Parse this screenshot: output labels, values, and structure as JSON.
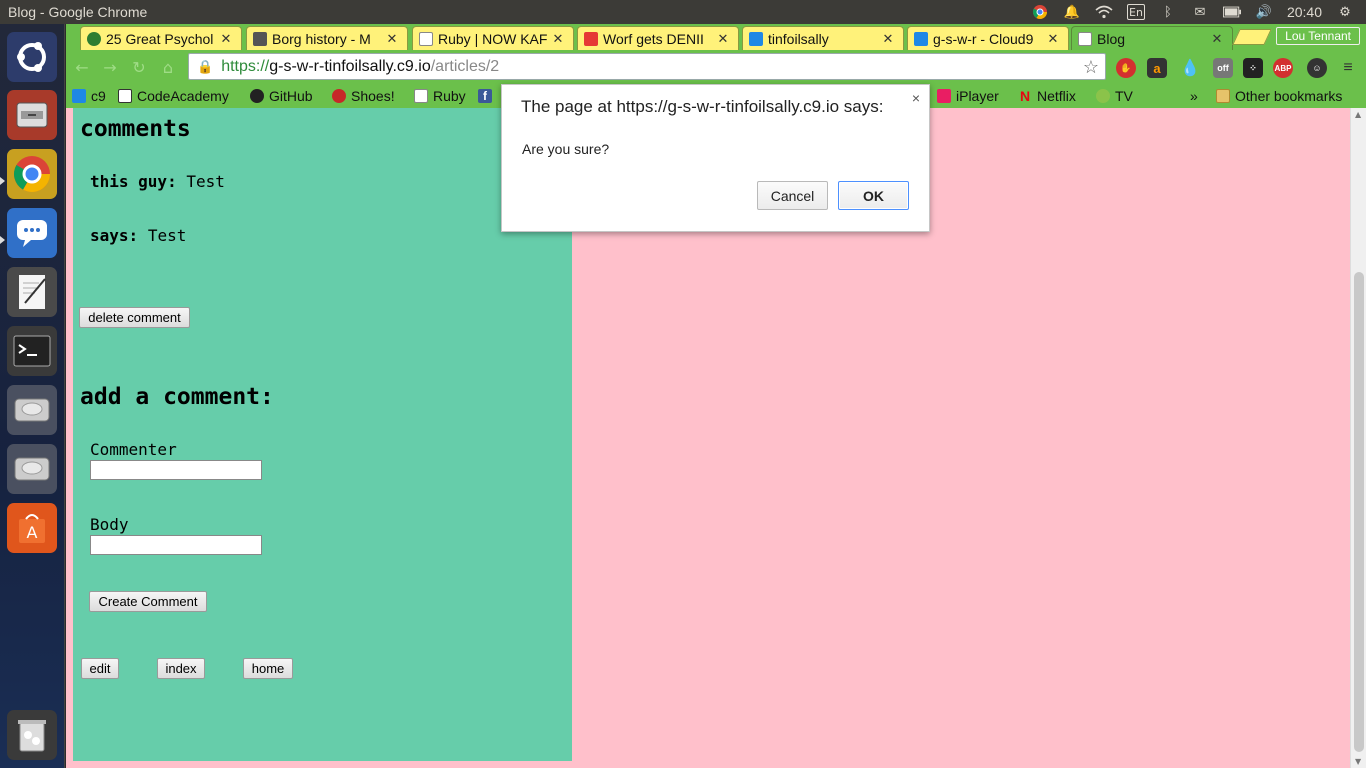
{
  "window": {
    "title": "Blog - Google Chrome"
  },
  "tray": {
    "lang": "En",
    "clock": "20:40",
    "profile": "Lou Tennant"
  },
  "tabs": [
    {
      "label": "25 Great Psychol",
      "color": "#2e7d32"
    },
    {
      "label": "Borg history - M",
      "color": "#555555"
    },
    {
      "label": "Ruby | NOW KAF",
      "color": "#dddddd"
    },
    {
      "label": "Worf gets DENII",
      "color": "#e53935"
    },
    {
      "label": "tinfoilsally",
      "color": "#1e88e5"
    },
    {
      "label": "g-s-w-r - Cloud9",
      "color": "#1e88e5"
    },
    {
      "label": "Blog",
      "color": "#eeeeee"
    }
  ],
  "address": {
    "scheme": "https://",
    "host": "g-s-w-r-tinfoilsally.c9.io",
    "path": "/articles/2"
  },
  "bookmarks": {
    "c9": "c9",
    "codeacademy": "CodeAcademy",
    "github": "GitHub",
    "shoes": "Shoes!",
    "ruby": "Ruby",
    "fb": "f",
    "iplayer": "iPlayer",
    "netflix": "Netflix",
    "tv": "TV",
    "overflow": "»",
    "other": "Other bookmarks"
  },
  "page": {
    "comments_heading": "comments",
    "commenter_label": "this guy:",
    "commenter_value": "Test",
    "says_label": "says:",
    "says_value": "Test",
    "delete_button": "delete comment",
    "add_heading": "add a comment:",
    "commenter_field_label": "Commenter",
    "body_field_label": "Body",
    "create_button": "Create Comment",
    "edit_button": "edit",
    "index_button": "index",
    "home_button": "home"
  },
  "dialog": {
    "title": "The page at https://g-s-w-r-tinfoilsally.c9.io says:",
    "message": "Are you sure?",
    "cancel": "Cancel",
    "ok": "OK",
    "close": "×"
  },
  "colors": {
    "page_bg": "#ffc0cb",
    "content_bg": "#66cdaa",
    "chrome_green": "#6bc04b",
    "tab_yellow": "#fff27a"
  }
}
